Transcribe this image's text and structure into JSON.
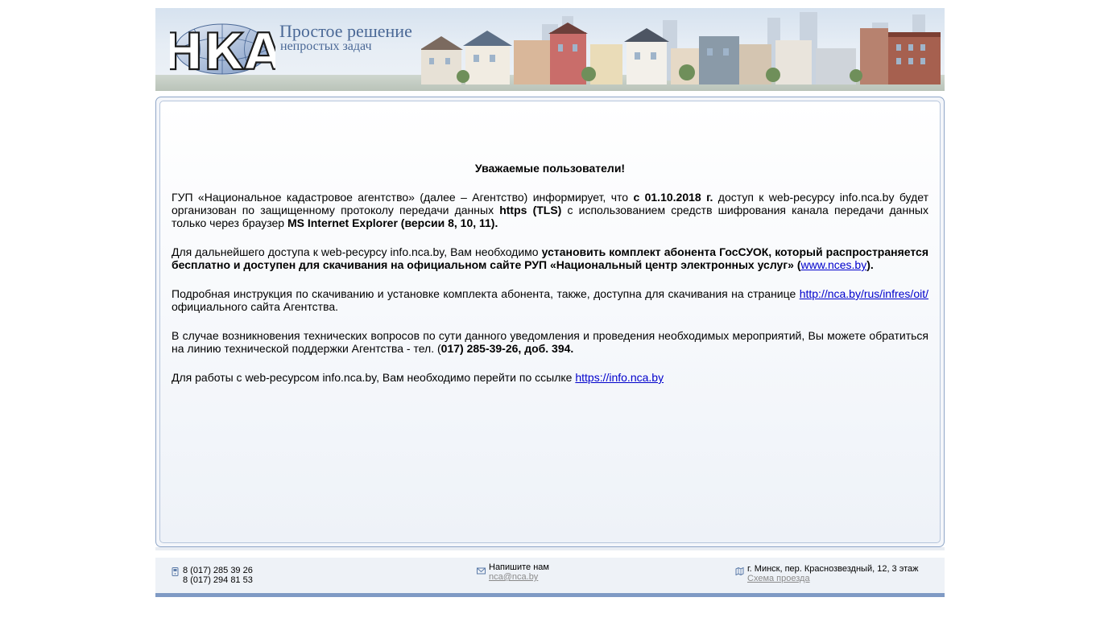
{
  "header": {
    "logo_text": "НКА",
    "slogan_line1": "Простое решение",
    "slogan_line2": "непростых задач"
  },
  "notice": {
    "heading": "Уважаемые пользователи!",
    "p1": {
      "t1": "ГУП «Национальное кадастровое агентство» (далее – Агентство) информирует, что ",
      "b1": "с 01.10.2018 г.",
      "t2": " доступ к web-ресурсу info.nca.by будет организован по защищенному протоколу передачи данных ",
      "b2": "https (TLS)",
      "t3": " с использованием средств шифрования канала передачи данных только через браузер ",
      "b3": "MS Internet Explorer (версии 8, 10, 11)."
    },
    "p2": {
      "t1": "Для дальнейшего доступа к web-ресурсу info.nca.by, Вам необходимо ",
      "b1": "установить комплект абонента ГосСУОК, который распространяется бесплатно и доступен для скачивания на официальном сайте РУП «Национальный центр электронных услуг» (",
      "link": "www.nces.by",
      "b2": ")."
    },
    "p3": {
      "t1": "Подробная инструкция по скачиванию и установке комплекта абонента, также, доступна для скачивания на странице ",
      "link": "http://nca.by/rus/infres/oit/",
      "t2": " официального сайта Агентства."
    },
    "p4": {
      "t1": "В случае возникновения технических вопросов по сути данного уведомления и проведения необходимых мероприятий, Вы можете обратиться на линию технической поддержки Агентства - тел. (",
      "b1": "017) 285-39-26, доб. 394."
    },
    "p5": {
      "t1": "Для работы с  web-ресурсом info.nca.by, Вам необходимо перейти по ссылке ",
      "link": "https://info.nca.by"
    }
  },
  "footer": {
    "phone1": "8 (017) 285 39 26",
    "phone2": "8 (017) 294 81 53",
    "write_label": "Напишите нам",
    "email": "nca@nca.by",
    "address": "г. Минск, пер. Краснозвездный, 12, 3 этаж",
    "directions_link": "Схема проезда"
  },
  "colors": {
    "accent": "#7f9ac4",
    "link": "#0000cc",
    "slogan": "#4a6896"
  }
}
